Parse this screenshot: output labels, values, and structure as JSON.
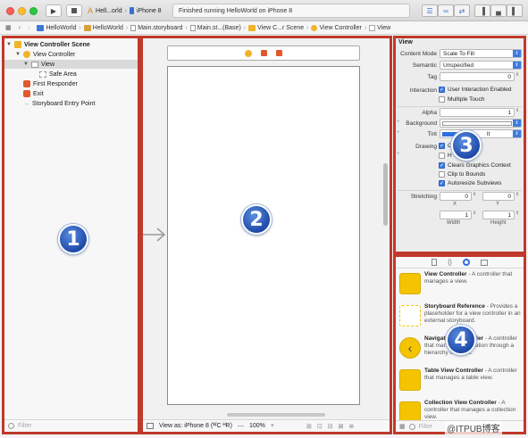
{
  "toolbar": {
    "scheme_target": "Hell...orld",
    "device": "iPhone 8",
    "status": "Finished running HelloWorld on iPhone 8"
  },
  "jumpbar": {
    "crumbs": [
      "HelloWorld",
      "HelloWorld",
      "Main.storyboard",
      "Main.st...(Base)",
      "View C...r Scene",
      "View Controller",
      "View"
    ]
  },
  "navigator": {
    "items": [
      "View Controller Scene",
      "View Controller",
      "View",
      "Safe Area",
      "First Responder",
      "Exit",
      "Storyboard Entry Point"
    ],
    "filter_placeholder": "Filter"
  },
  "canvas": {
    "view_as": "View as: iPhone 8 (ᵂC ᴴR)",
    "zoom_minus": "—",
    "zoom": "100%",
    "zoom_plus": "+"
  },
  "inspector": {
    "section": "View",
    "content_mode_label": "Content Mode",
    "content_mode_value": "Scale To Fill",
    "semantic_label": "Semantic",
    "semantic_value": "Unspecified",
    "tag_label": "Tag",
    "tag_value": "0",
    "interaction_label": "Interaction",
    "interaction_opt1": "User Interaction Enabled",
    "interaction_opt2": "Multiple Touch",
    "alpha_label": "Alpha",
    "alpha_value": "1",
    "background_label": "Background",
    "tint_label": "Tint",
    "tint_value": "lt",
    "drawing_label": "Drawing",
    "drawing_opt1": "O",
    "drawing_opt2": "H",
    "drawing_opt3": "Clears Graphics Context",
    "drawing_opt4": "Clip to Bounds",
    "drawing_opt5": "Autoresize Subviews",
    "stretching_label": "Stretching",
    "stretch_x": "0",
    "stretch_y": "0",
    "stretch_w": "1",
    "stretch_h": "1",
    "x_label": "X",
    "y_label": "Y",
    "width_label": "Width",
    "height_label": "Height"
  },
  "library": {
    "filter_placeholder": "Filter",
    "items": [
      {
        "title": "View Controller",
        "desc": " - A controller that manages a view."
      },
      {
        "title": "Storyboard Reference",
        "desc": " - Provides a placeholder for a view controller in an external storyboard."
      },
      {
        "title": "Navigation Controller",
        "desc": " - A controller that manages navigation through a hierarchy of views."
      },
      {
        "title": "Table View Controller",
        "desc": " - A controller that manages a table view."
      },
      {
        "title": "Collection View Controller",
        "desc": " - A controller that manages a collection view."
      }
    ]
  },
  "badges": [
    "1",
    "2",
    "3",
    "4"
  ],
  "watermark": "@ITPUB博客",
  "colors": {
    "accent": "#3d7be0",
    "border_highlight": "#c0392b",
    "lib_yellow": "#f4c400",
    "badge_blue": "#1f4aa8"
  }
}
